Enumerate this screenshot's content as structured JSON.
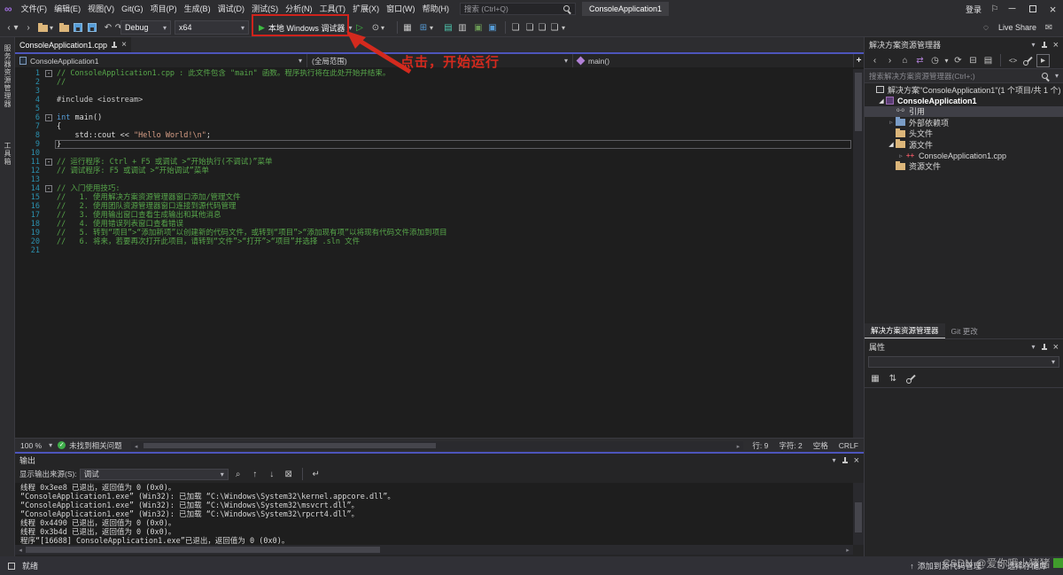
{
  "colors": {
    "accent_line": "#4d55bb",
    "annotation_red": "#cf231c",
    "editor_bg": "#1e1e1e",
    "panel_bg": "#252526",
    "chrome_bg": "#2d2d30",
    "comment_green": "#57a64a",
    "keyword_blue": "#569cd6",
    "string_orange": "#d69d85",
    "line_number_teal": "#2b91af",
    "run_green": "#3dbb41"
  },
  "titlebar": {
    "menus": [
      "文件(F)",
      "编辑(E)",
      "视图(V)",
      "Git(G)",
      "项目(P)",
      "生成(B)",
      "调试(D)",
      "测试(S)",
      "分析(N)",
      "工具(T)",
      "扩展(X)",
      "窗口(W)",
      "帮助(H)"
    ],
    "search_placeholder": "搜索 (Ctrl+Q)",
    "app_title": "ConsoleApplication1",
    "signin": "登录"
  },
  "toolbar": {
    "config": "Debug",
    "platform": "x64",
    "run_label": "本地 Windows 调试器",
    "live_share": "Live Share"
  },
  "annotation": {
    "text": "点击，开始运行",
    "color": "#d42a1e"
  },
  "left_strip": {
    "tabs": [
      "服务器资源管理器",
      "工具箱"
    ]
  },
  "editor": {
    "tab_title": "ConsoleApplication1.cpp",
    "breadcrumb": {
      "project": "ConsoleApplication1",
      "scope": "(全局范围)",
      "member": "main()"
    },
    "status": {
      "zoom": "100 %",
      "health": "未找到相关问题",
      "line": "行: 9",
      "col": "字符: 2",
      "spaces": "空格",
      "eol": "CRLF"
    },
    "code": {
      "lines": [
        {
          "n": 1,
          "fold": true,
          "t": [
            [
              "cmt",
              "// ConsoleApplication1.cpp : 此文件包含 \"main\" 函数。程序执行将在此处开始并结束。"
            ]
          ]
        },
        {
          "n": 2,
          "t": [
            [
              "cmt",
              "//"
            ]
          ]
        },
        {
          "n": 3,
          "t": []
        },
        {
          "n": 4,
          "t": [
            [
              "pp",
              "#include <iostream>"
            ]
          ]
        },
        {
          "n": 5,
          "t": []
        },
        {
          "n": 6,
          "fold": true,
          "t": [
            [
              "kw",
              "int"
            ],
            [
              "pln",
              " main()"
            ]
          ]
        },
        {
          "n": 7,
          "t": [
            [
              "pln",
              "{"
            ]
          ]
        },
        {
          "n": 8,
          "t": [
            [
              "pln",
              "    std::cout << "
            ],
            [
              "str",
              "\"Hello World!\\n\""
            ],
            [
              "pln",
              ";"
            ]
          ]
        },
        {
          "n": 9,
          "cur": true,
          "t": [
            [
              "pln",
              "}"
            ]
          ]
        },
        {
          "n": 10,
          "t": []
        },
        {
          "n": 11,
          "fold": true,
          "t": [
            [
              "cmt",
              "// 运行程序: Ctrl + F5 或调试 >“开始执行(不调试)”菜单"
            ]
          ]
        },
        {
          "n": 12,
          "t": [
            [
              "cmt",
              "// 调试程序: F5 或调试 >“开始调试”菜单"
            ]
          ]
        },
        {
          "n": 13,
          "t": []
        },
        {
          "n": 14,
          "fold": true,
          "t": [
            [
              "cmt",
              "// 入门使用技巧: "
            ]
          ]
        },
        {
          "n": 15,
          "t": [
            [
              "cmt",
              "//   1. 使用解决方案资源管理器窗口添加/管理文件"
            ]
          ]
        },
        {
          "n": 16,
          "t": [
            [
              "cmt",
              "//   2. 使用团队资源管理器窗口连接到源代码管理"
            ]
          ]
        },
        {
          "n": 17,
          "t": [
            [
              "cmt",
              "//   3. 使用输出窗口查看生成输出和其他消息"
            ]
          ]
        },
        {
          "n": 18,
          "t": [
            [
              "cmt",
              "//   4. 使用错误列表窗口查看错误"
            ]
          ]
        },
        {
          "n": 19,
          "t": [
            [
              "cmt",
              "//   5. 转到“项目”>“添加新项”以创建新的代码文件，或转到“项目”>“添加现有项”以将现有代码文件添加到项目"
            ]
          ]
        },
        {
          "n": 20,
          "t": [
            [
              "cmt",
              "//   6. 将来，若要再次打开此项目，请转到“文件”>“打开”>“项目”并选择 .sln 文件"
            ]
          ]
        },
        {
          "n": 21,
          "t": []
        }
      ]
    }
  },
  "output": {
    "title": "输出",
    "source_label": "显示输出来源(S):",
    "source_value": "调试",
    "lines": [
      "线程 0x3ee8 已退出，返回值为 0 (0x0)。",
      "“ConsoleApplication1.exe” (Win32): 已加载 “C:\\Windows\\System32\\kernel.appcore.dll”。",
      "“ConsoleApplication1.exe” (Win32): 已加载 “C:\\Windows\\System32\\msvcrt.dll”。",
      "“ConsoleApplication1.exe” (Win32): 已加载 “C:\\Windows\\System32\\rpcrt4.dll”。",
      "线程 0x4490 已退出，返回值为 0 (0x0)。",
      "线程 0x3b4d 已退出，返回值为 0 (0x0)。",
      "程序“[16688] ConsoleApplication1.exe”已退出，返回值为 0 (0x0)。"
    ]
  },
  "solution_explorer": {
    "title": "解决方案资源管理器",
    "search_placeholder": "搜索解决方案资源管理器(Ctrl+;)",
    "tree": [
      {
        "label": "解决方案\"ConsoleApplication1\"(1 个项目/共 1 个)",
        "icon": "solution",
        "indent": 0,
        "arrow": null
      },
      {
        "label": "ConsoleApplication1",
        "icon": "project",
        "indent": 1,
        "arrow": "open",
        "bold": true
      },
      {
        "label": "引用",
        "icon": "refs",
        "indent": 2,
        "arrow": null,
        "selected": true
      },
      {
        "label": "外部依赖项",
        "icon": "deps",
        "indent": 2,
        "arrow": "closed"
      },
      {
        "label": "头文件",
        "icon": "folder",
        "indent": 2,
        "arrow": null
      },
      {
        "label": "源文件",
        "icon": "folder",
        "indent": 2,
        "arrow": "open"
      },
      {
        "label": "ConsoleApplication1.cpp",
        "icon": "cpp",
        "indent": 3,
        "arrow": "closed"
      },
      {
        "label": "资源文件",
        "icon": "folder",
        "indent": 2,
        "arrow": null
      }
    ],
    "tabs": [
      {
        "label": "解决方案资源管理器"
      },
      {
        "label": "Git 更改"
      }
    ]
  },
  "properties": {
    "title": "属性"
  },
  "statusbar": {
    "ready": "就绪",
    "add_scc": "添加到源代码管理",
    "select_repo": "选择存储库"
  },
  "watermark": {
    "text": "CSDN @爱你哦小猪猪"
  }
}
